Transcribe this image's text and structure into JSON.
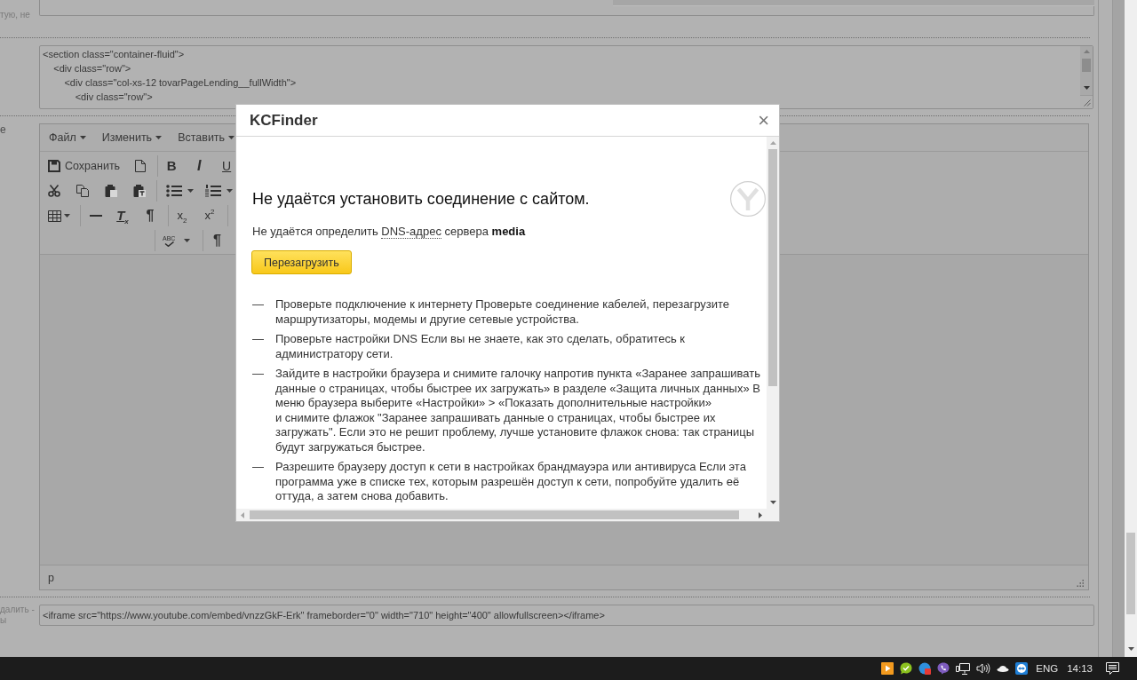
{
  "form": {
    "rows": [
      {
        "kind": "text",
        "label_lines": [
          "тую, не"
        ]
      },
      {
        "kind": "code",
        "lines": [
          "<section class=\"container-fluid\">",
          "    <div class=\"row\">",
          "        <div class=\"col-xs-12 tovarPageLending__fullWidth\">",
          "            <div class=\"row\">"
        ]
      },
      {
        "kind": "editor",
        "label_lines": [
          "е"
        ],
        "menu": [
          {
            "label": "Файл"
          },
          {
            "label": "Изменить"
          },
          {
            "label": "Вставить"
          }
        ],
        "toolbar": [
          [
            {
              "kind": "save",
              "label": "Сохранить"
            },
            {
              "kind": "newdoc"
            },
            {
              "kind": "separator"
            },
            {
              "kind": "bold",
              "text": "B"
            },
            {
              "kind": "italic",
              "text": "I"
            },
            {
              "kind": "underline",
              "text": "U"
            }
          ],
          [
            {
              "kind": "cut"
            },
            {
              "kind": "copy"
            },
            {
              "kind": "paste"
            },
            {
              "kind": "pastetext"
            },
            {
              "kind": "separator"
            },
            {
              "kind": "bullets"
            },
            {
              "kind": "numbering"
            }
          ],
          [
            {
              "kind": "table"
            },
            {
              "kind": "separator"
            },
            {
              "kind": "rule"
            },
            {
              "kind": "clearformat",
              "text": "T$_{x}$"
            },
            {
              "kind": "pilcrow",
              "text": "¶"
            },
            {
              "kind": "separator"
            },
            {
              "kind": "subscript",
              "text": "x$_{2}$"
            },
            {
              "kind": "superscript",
              "text": "x$^{2}$"
            },
            {
              "kind": "separator"
            }
          ],
          [
            {
              "kind": "separator"
            },
            {
              "kind": "spellcheck",
              "text": "ABC"
            },
            {
              "kind": "separator"
            },
            {
              "kind": "pilcrow",
              "text": "¶"
            }
          ]
        ],
        "path": "p"
      },
      {
        "kind": "text",
        "label_lines": [
          "далить -",
          "ы"
        ],
        "value": "<iframe src=\"https://www.youtube.com/embed/vnzzGkF-Erk\" frameborder=\"0\" width=\"710\" height=\"400\" allowfullscreen></iframe>"
      }
    ]
  },
  "dialog": {
    "title": "KCFinder",
    "close": "×",
    "heading": "Не удаётся установить соединение с сайтом.",
    "message": [
      {
        "kind": "plain",
        "text": "Не удаётся определить"
      },
      {
        "kind": "term",
        "text": "DNS-адрес"
      },
      {
        "kind": "plain",
        "text": "сервера"
      },
      {
        "kind": "strong",
        "text": "media"
      }
    ],
    "button": "Перезагрузить",
    "tips": [
      {
        "marker": "—",
        "text": [
          "Проверьте подключение к интернету Проверьте соединение кабелей, перезагрузите маршрутизаторы, модемы и другие сетевые устройства."
        ]
      },
      {
        "marker": "—",
        "text": [
          "Проверьте настройки DNS Если вы не знаете, как это сделать, обратитесь к администратору сети."
        ]
      },
      {
        "marker": "—",
        "text": [
          "Зайдите в настройки браузера и снимите галочку напротив пункта «Заранее запрашивать данные о страницах, чтобы быстрее их загружать» в разделе «Защита личных данных» В меню браузера выберите «Настройки» > «Показать дополнительные настройки»",
          "и снимите флажок \"Заранее запрашивать данные о страницах, чтобы быстрее их загружать\". Если это не решит проблему, лучше установите флажок снова: так страницы будут загружаться быстрее."
        ]
      },
      {
        "marker": "—",
        "text": [
          "Разрешите браузеру доступ к сети в настройках брандмауэра или антивируса Если эта программа уже в списке тех, которым разрешён доступ к сети, попробуйте удалить её оттуда, а затем снова добавить."
        ]
      }
    ]
  },
  "taskbar": {
    "language": "ENG",
    "time": "14:13"
  }
}
